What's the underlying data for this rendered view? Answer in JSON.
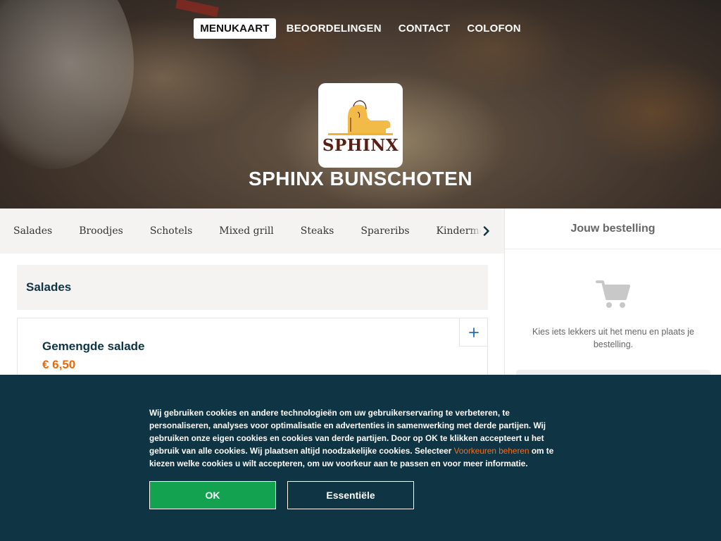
{
  "nav": {
    "items": [
      {
        "label": "MENUKAART",
        "active": true
      },
      {
        "label": "BEOORDELINGEN"
      },
      {
        "label": "CONTACT"
      },
      {
        "label": "COLOFON"
      }
    ]
  },
  "restaurant": {
    "logo_text": "SPHINX",
    "name": "SPHINX BUNSCHOTEN"
  },
  "categories": [
    "Salades",
    "Broodjes",
    "Schotels",
    "Mixed grill",
    "Steaks",
    "Spareribs",
    "Kinderme"
  ],
  "menu": {
    "section_title": "Salades",
    "products": [
      {
        "name": "Gemengde salade",
        "price": "€ 6,50"
      }
    ]
  },
  "basket": {
    "title": "Jouw bestelling",
    "empty_text": "Kies iets lekkers uit het menu en plaats je bestelling."
  },
  "cookie": {
    "text_before": "Wij gebruiken cookies en andere technologieën om uw gebruikerservaring te verbeteren, te personaliseren, analyses voor optimalisatie en advertenties in samenwerking met derde partijen. Wij gebruiken onze eigen cookies en cookies van derde partijen. Door op OK te klikken accepteert u het gebruik van alle cookies. Wij plaatsen altijd noodzakelijke cookies. Selecteer ",
    "link": "Voorkeuren beheren",
    "text_after": " om te kiezen welke cookies u wilt accepteren, om uw voorkeur aan te passen en voor meer informatie.",
    "ok_label": "OK",
    "essential_label": "Essentiële"
  },
  "colors": {
    "dark_teal": "#0f3443",
    "accent_orange": "#e8690a",
    "ok_green": "#13a24f"
  },
  "icons": {
    "next": "chevron-right-icon",
    "add": "plus-icon",
    "basket": "shopping-cart-icon"
  }
}
